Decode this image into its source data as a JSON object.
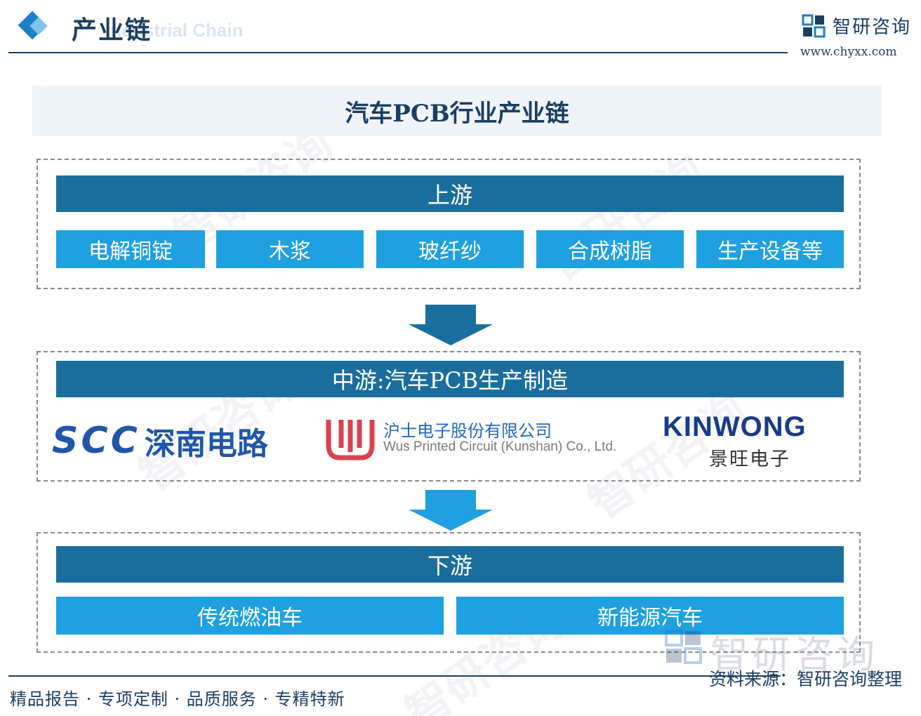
{
  "header": {
    "title": "产业链",
    "subtitle": "Industrial Chain",
    "brand": "智研咨询",
    "url": "www.chyxx.com"
  },
  "main_title": "汽车PCB行业产业链",
  "upstream": {
    "label": "上游",
    "items": [
      "电解铜锭",
      "木浆",
      "玻纤纱",
      "合成树脂",
      "生产设备等"
    ]
  },
  "midstream": {
    "label": "中游:汽车PCB生产制造",
    "companies": {
      "scc_en": "SCC",
      "scc_cn": "深南电路",
      "wus_cn": "沪士电子股份有限公司",
      "wus_en": "Wus Printed Circuit (Kunshan) Co., Ltd.",
      "kinwong_en": "KINWONG",
      "kinwong_cn": "景旺电子"
    }
  },
  "downstream": {
    "label": "下游",
    "items": [
      "传统燃油车",
      "新能源汽车"
    ]
  },
  "footer": {
    "slogan": "精品报告 · 专项定制 · 品质服务 · 专精特新",
    "source": "资料来源：智研咨询整理",
    "watermark": "智研咨询"
  },
  "colors": {
    "dark_bar": "#1a6e9e",
    "light_item": "#1fa0e0",
    "title_text": "#1b3f63",
    "arrow": "#1a6e9e"
  }
}
